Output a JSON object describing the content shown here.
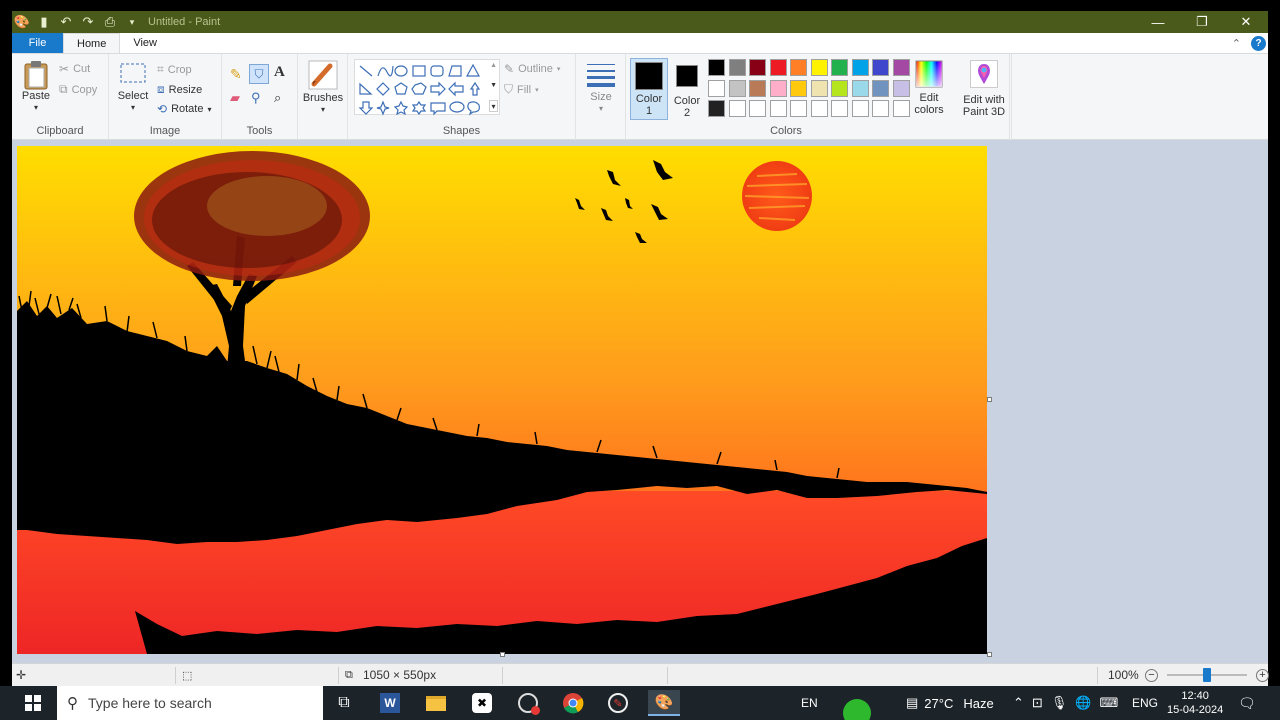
{
  "window": {
    "title": "Untitled - Paint",
    "controls": {
      "minimize": "—",
      "maximize": "❐",
      "close": "✕"
    }
  },
  "tabs": {
    "file": "File",
    "home": "Home",
    "view": "View"
  },
  "ribbon": {
    "clipboard": {
      "paste": "Paste",
      "cut": "Cut",
      "copy": "Copy",
      "label": "Clipboard"
    },
    "image": {
      "select": "Select",
      "crop": "Crop",
      "resize": "Resize",
      "rotate": "Rotate",
      "label": "Image"
    },
    "tools": {
      "label": "Tools"
    },
    "brushes": {
      "label": "Brushes"
    },
    "shapes": {
      "outline": "Outline",
      "fill": "Fill",
      "label": "Shapes"
    },
    "size": {
      "label": "Size"
    },
    "color1": {
      "label": "Color",
      "num": "1",
      "value": "#000000"
    },
    "color2": {
      "label": "Color",
      "num": "2",
      "value": "#000000"
    },
    "colors": {
      "label": "Colors",
      "palette_row1": [
        "#000000",
        "#7f7f7f",
        "#880015",
        "#ed1c24",
        "#ff7f27",
        "#fff200",
        "#22b14c",
        "#00a2e8",
        "#3f48cc",
        "#a349a4"
      ],
      "palette_row2": [
        "#ffffff",
        "#c3c3c3",
        "#b97a57",
        "#ffaec9",
        "#ffc90e",
        "#efe4b0",
        "#b5e61d",
        "#99d9ea",
        "#7092be",
        "#c8bfe7"
      ],
      "palette_row3": [
        "#222222",
        "#ffffff",
        "#ffffff",
        "#ffffff",
        "#ffffff",
        "#ffffff",
        "#ffffff",
        "#ffffff",
        "#ffffff",
        "#ffffff"
      ]
    },
    "edit_colors": {
      "line1": "Edit",
      "line2": "colors"
    },
    "paint3d": {
      "line1": "Edit with",
      "line2": "Paint 3D"
    }
  },
  "status": {
    "dimensions": "1050 × 550px",
    "zoom": "100%",
    "zoom_level": 1.0
  },
  "taskbar": {
    "search_placeholder": "Type here to search",
    "lang": "EN",
    "weather_temp": "27°C",
    "weather_desc": "Haze",
    "input_lang": "ENG",
    "time": "12:40",
    "date": "15-04-2024"
  }
}
